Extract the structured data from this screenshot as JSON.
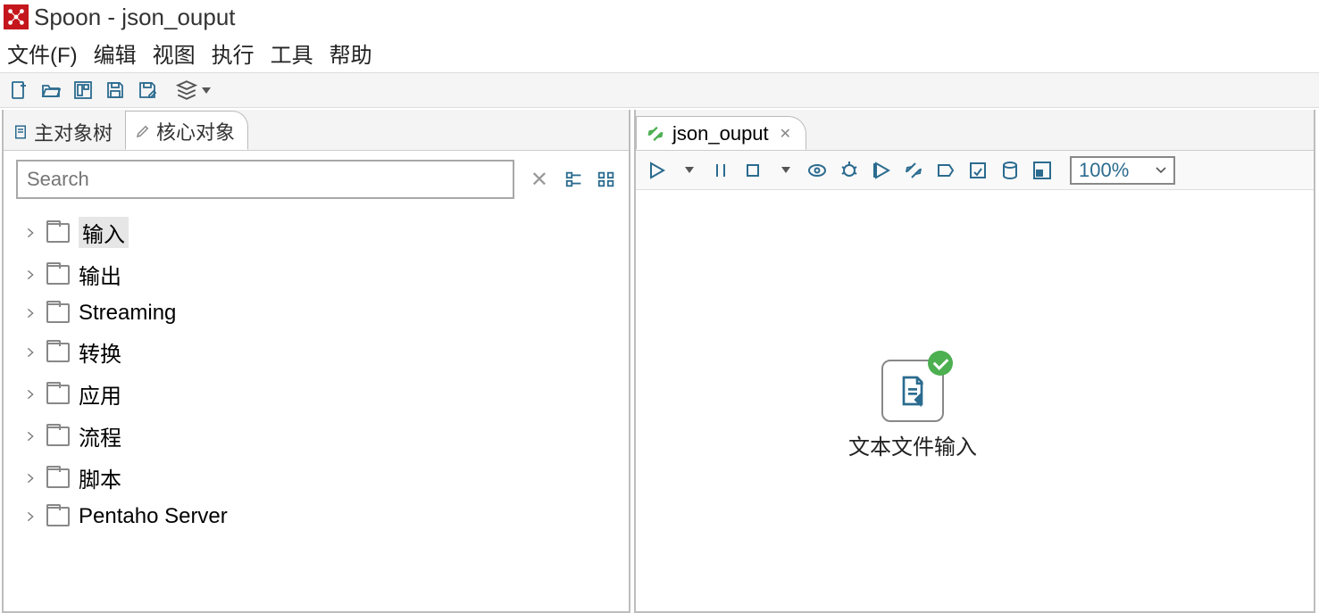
{
  "window": {
    "title": "Spoon - json_ouput"
  },
  "menu": {
    "file": "文件(F)",
    "edit": "编辑",
    "view": "视图",
    "run": "执行",
    "tools": "工具",
    "help": "帮助"
  },
  "side_tabs": {
    "main_tree": "主对象树",
    "core_objects": "核心对象"
  },
  "search": {
    "placeholder": "Search"
  },
  "tree": {
    "items": [
      {
        "label": "输入"
      },
      {
        "label": "输出"
      },
      {
        "label": "Streaming"
      },
      {
        "label": "转换"
      },
      {
        "label": "应用"
      },
      {
        "label": "流程"
      },
      {
        "label": "脚本"
      },
      {
        "label": "Pentaho Server"
      }
    ]
  },
  "editor": {
    "tab_label": "json_ouput",
    "zoom": "100%",
    "step_label": "文本文件输入"
  }
}
